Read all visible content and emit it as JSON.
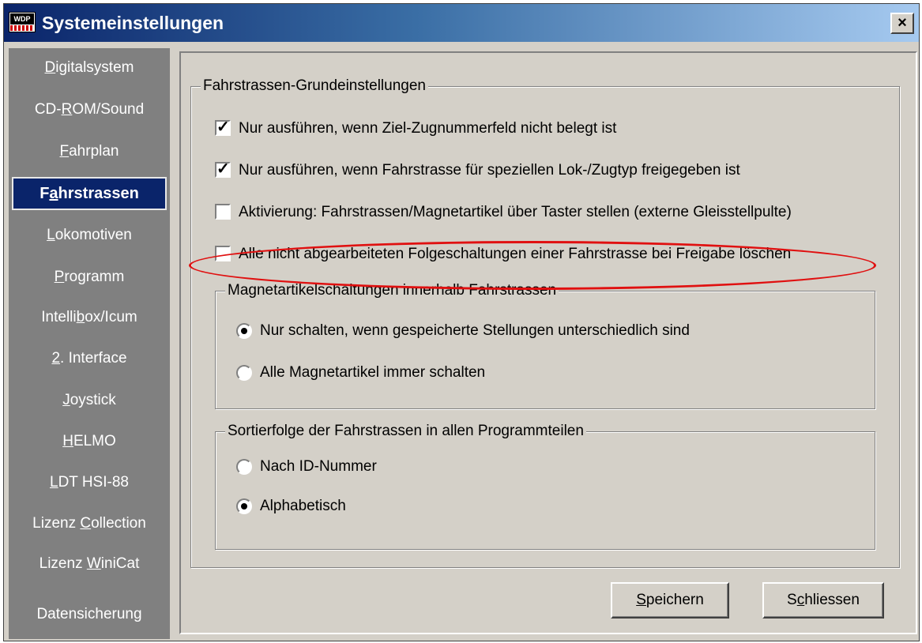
{
  "window": {
    "title": "Systemeinstellungen",
    "close_label": "×",
    "app_icon_text": "WDP"
  },
  "sidebar": {
    "items": [
      {
        "pre": "",
        "ul": "D",
        "post": "igitalsystem"
      },
      {
        "pre": "CD-",
        "ul": "R",
        "post": "OM/Sound"
      },
      {
        "pre": "",
        "ul": "F",
        "post": "ahrplan"
      },
      {
        "pre": "F",
        "ul": "a",
        "post": "hrstrassen"
      },
      {
        "pre": "",
        "ul": "L",
        "post": "okomotiven"
      },
      {
        "pre": "",
        "ul": "P",
        "post": "rogramm"
      },
      {
        "pre": "Intelli",
        "ul": "b",
        "post": "ox/Icum"
      },
      {
        "pre": "",
        "ul": "2",
        "post": ". Interface"
      },
      {
        "pre": "",
        "ul": "J",
        "post": "oystick"
      },
      {
        "pre": "",
        "ul": "H",
        "post": "ELMO"
      },
      {
        "pre": "",
        "ul": "L",
        "post": "DT HSI-88"
      },
      {
        "pre": "Lizenz ",
        "ul": "C",
        "post": "ollection"
      },
      {
        "pre": "Lizenz ",
        "ul": "W",
        "post": "iniCat"
      },
      {
        "pre": "Datensicherung",
        "ul": "",
        "post": ""
      }
    ],
    "active_index": 3
  },
  "main": {
    "group1": {
      "title": "Fahrstrassen-Grundeinstellungen",
      "options": [
        {
          "label": "Nur ausführen, wenn Ziel-Zugnummerfeld nicht belegt ist",
          "checked": true
        },
        {
          "label": "Nur ausführen, wenn Fahrstrasse für speziellen Lok-/Zugtyp freigegeben ist",
          "checked": true
        },
        {
          "label": "Aktivierung: Fahrstrassen/Magnetartikel über Taster stellen (externe Gleisstellpulte)",
          "checked": false
        },
        {
          "label": "Alle nicht abgearbeiteten Folgeschaltungen einer Fahrstrasse bei Freigabe löschen",
          "checked": false
        }
      ]
    },
    "group2": {
      "title": "Magnetartikelschaltungen innerhalb Fahrstrassen",
      "options": [
        {
          "label": "Nur schalten, wenn gespeicherte Stellungen unterschiedlich sind",
          "selected": true
        },
        {
          "label": "Alle Magnetartikel immer schalten",
          "selected": false
        }
      ]
    },
    "group3": {
      "title": "Sortierfolge der Fahrstrassen in allen Programmteilen",
      "options": [
        {
          "label": "Nach ID-Nummer",
          "selected": false
        },
        {
          "label": "Alphabetisch",
          "selected": true
        }
      ]
    },
    "highlight_color": "#e01010"
  },
  "footer": {
    "save": {
      "ul": "S",
      "post": "peichern"
    },
    "close": {
      "pre": "S",
      "ul": "c",
      "post": "hliessen"
    }
  },
  "colors": {
    "title_bar": "#0a246a",
    "sidebar_bg": "#808080",
    "dialog_bg": "#d4d0c8"
  }
}
